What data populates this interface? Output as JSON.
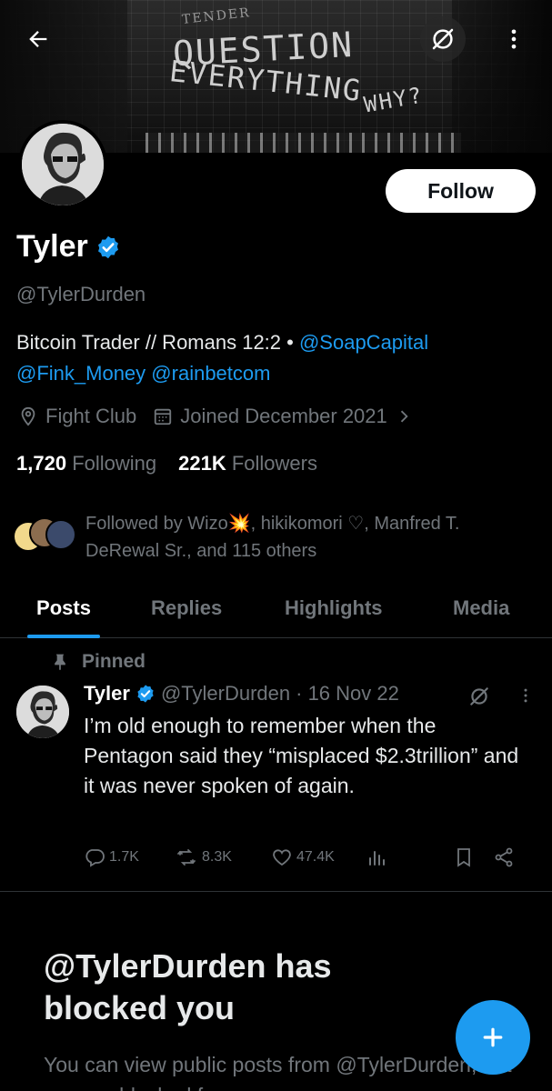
{
  "banner": {
    "graffiti_line1": "QUESTION",
    "graffiti_line2": "EVERYTHING",
    "graffiti_line3": "WHY?",
    "graffiti_small": "TENDER"
  },
  "profile": {
    "name": "Tyler",
    "handle": "@TylerDurden",
    "follow_label": "Follow",
    "bio_text": "Bitcoin Trader // Romans 12:2 • ",
    "bio_links": [
      "@SoapCapital",
      "@Fink_Money",
      "@rainbetcom"
    ],
    "location": "Fight Club",
    "joined": "Joined December 2021",
    "following_count": "1,720",
    "following_label": "Following",
    "followers_count": "221K",
    "followers_label": "Followers",
    "followed_by": "Followed by Wizo💥, hikikomori ♡, Manfred T. DeRewal Sr., and 115 others"
  },
  "tabs": [
    "Posts",
    "Replies",
    "Highlights",
    "Media"
  ],
  "pinned_post": {
    "pinned_label": "Pinned",
    "author_name": "Tyler",
    "author_handle": "@TylerDurden",
    "date": "· 16 Nov 22",
    "text": "I’m old enough to remember when the Pentagon said they “misplaced $2.3trillion” and it was never spoken of again.",
    "replies": "1.7K",
    "reposts": "8.3K",
    "likes": "47.4K"
  },
  "blocked": {
    "title": "@TylerDurden has blocked you",
    "subtitle": "You can view public posts from @TylerDurden, but you are blocked f"
  },
  "colors": {
    "accent": "#1d9bf0",
    "muted": "#71767b",
    "text": "#e7e9ea",
    "background": "#000000"
  }
}
